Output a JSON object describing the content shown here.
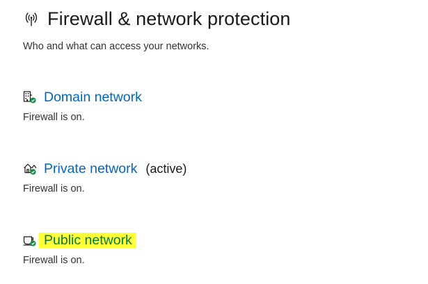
{
  "header": {
    "icon": "antenna-icon",
    "title": "Firewall & network protection"
  },
  "subtitle": "Who and what can access your networks.",
  "networks": [
    {
      "icon": "domain-building-icon",
      "label": "Domain network",
      "active_label": "",
      "status": "Firewall is on.",
      "highlighted": false
    },
    {
      "icon": "private-home-icon",
      "label": "Private network",
      "active_label": "(active)",
      "status": "Firewall is on.",
      "highlighted": false
    },
    {
      "icon": "public-cafe-icon",
      "label": "Public network",
      "active_label": "",
      "status": "Firewall is on.",
      "highlighted": true
    }
  ],
  "colors": {
    "link": "#0067c0",
    "status_check": "#10893e",
    "highlight": "#ffff3a"
  }
}
